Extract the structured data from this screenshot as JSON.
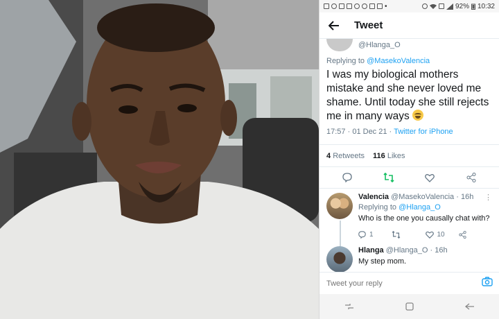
{
  "status_bar": {
    "battery": "92%",
    "time": "10:32",
    "left_icons": [
      "message-icon",
      "voicemail-icon",
      "gallery-icon",
      "google-icon",
      "sync-icon",
      "check-icon",
      "download-icon",
      "dot-icon"
    ],
    "right_icons": [
      "alarm-icon",
      "wifi-icon",
      "data-icon",
      "signal-icon",
      "battery-icon"
    ]
  },
  "header": {
    "title": "Tweet",
    "back_icon": "back-arrow-icon"
  },
  "tweet": {
    "handle": "@Hlanga_O",
    "replying_prefix": "Replying to",
    "replying_to": "@MasekoValencia",
    "text": "I was my biological mothers mistake and she never loved me shame. Until today she still rejects me in many ways",
    "emoji": "laughing-tears-emoji",
    "time": "17:57",
    "date": "01 Dec 21",
    "separator": "·",
    "source": "Twitter for iPhone",
    "retweets_count": "4",
    "retweets_label": "Retweets",
    "likes_count": "116",
    "likes_label": "Likes"
  },
  "replies": [
    {
      "name": "Valencia",
      "handle": "@MasekoValencia",
      "age": "· 16h",
      "replying_prefix": "Replying to",
      "replying_to": "@Hlanga_O",
      "text": "Who is the one you causally chat with?",
      "reply_count": "1",
      "retweet_count": "",
      "like_count": "10"
    },
    {
      "name": "Hlanga",
      "handle": "@Hlanga_O",
      "age": "· 16h",
      "text": "My step mom."
    }
  ],
  "compose": {
    "placeholder": "Tweet your reply"
  },
  "colors": {
    "accent": "#1da1f2",
    "retweet_green": "#17bf63",
    "text": "#14171a",
    "muted": "#657786"
  }
}
